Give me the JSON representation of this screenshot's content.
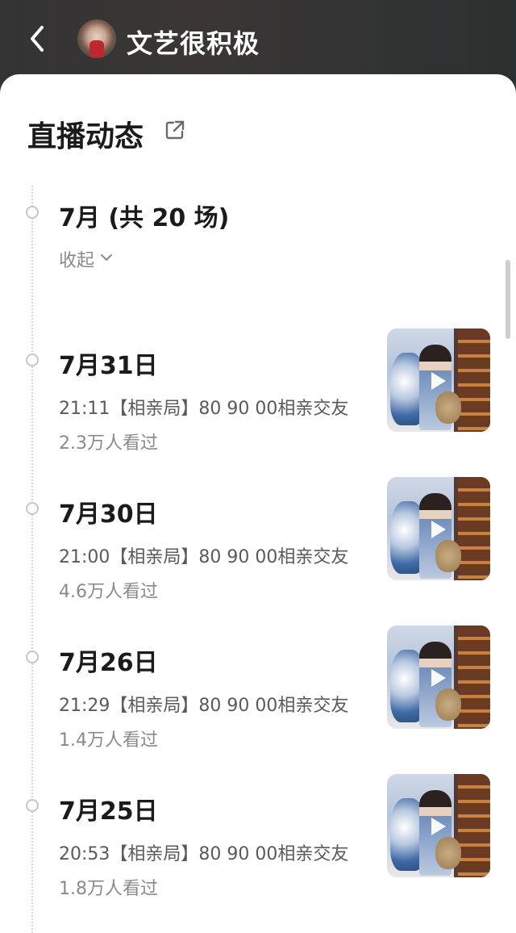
{
  "header": {
    "title": "文艺很积极"
  },
  "section": {
    "title": "直播动态"
  },
  "month_group": {
    "title": "7月 (共 20 场)",
    "collapse_label": "收起"
  },
  "items": [
    {
      "date": "7月31日",
      "desc": "21:11【相亲局】80 90 00相亲交友",
      "views": "2.3万人看过"
    },
    {
      "date": "7月30日",
      "desc": "21:00【相亲局】80 90 00相亲交友",
      "views": "4.6万人看过"
    },
    {
      "date": "7月26日",
      "desc": "21:29【相亲局】80 90 00相亲交友",
      "views": "1.4万人看过"
    },
    {
      "date": "7月25日",
      "desc": "20:53【相亲局】80 90 00相亲交友",
      "views": "1.8万人看过"
    }
  ],
  "icons": {
    "back": "back-icon",
    "external": "external-link-icon",
    "chevron": "chevron-down-icon",
    "play": "play-icon"
  }
}
